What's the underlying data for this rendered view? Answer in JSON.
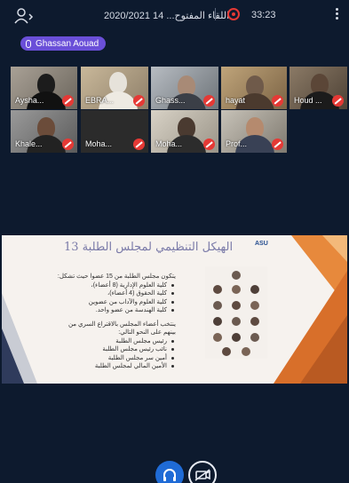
{
  "top_bar": {
    "meeting_title": "2020/2021 14 ...اللقاء المفتوح",
    "timer": "33:23"
  },
  "active_speaker": "Ghassan Aouad",
  "participants": [
    {
      "name": "Aysha...",
      "muted": true
    },
    {
      "name": "EBRA...",
      "muted": true
    },
    {
      "name": "Ghass...",
      "muted": true,
      "active": true
    },
    {
      "name": "hayat",
      "muted": true
    },
    {
      "name": "Houd ...",
      "muted": true
    },
    {
      "name": "Khale...",
      "muted": true
    },
    {
      "name": "Moha...",
      "muted": true
    },
    {
      "name": "Moha...",
      "muted": true
    },
    {
      "name": "Prof...",
      "muted": true
    }
  ],
  "slide": {
    "title": "الهيكل التنظيمي لمجلس الطلبة 13",
    "bullets_intro": "يتكون مجلس الطلبة من 15 عضوا حيث تشكل:",
    "bullets": [
      "كلية العلوم الإدارية (8 أعضاء)،",
      "كلية الحقوق (4 أعضاء)،",
      "كلية العلوم والآداب من عضوين",
      "كلية الهندسة من عضو واحد."
    ],
    "election_intro": "ينتخب أعضاء المجلس بالاقتراع السري من بينهم على النحو التالي:",
    "roles": [
      "رئيس مجلس الطلبة",
      "نائب رئيس مجلس الطلبة",
      "أمين سر مجلس الطلبة",
      "الأمين المالي لمجلس الطلبة"
    ],
    "logo_text": "ASU"
  },
  "colors": {
    "background": "#0d1a2e",
    "accent": "#6a4fd8",
    "record": "#e53935",
    "active_tile": "#3ecf6a",
    "audio_button": "#1f6bd6"
  }
}
